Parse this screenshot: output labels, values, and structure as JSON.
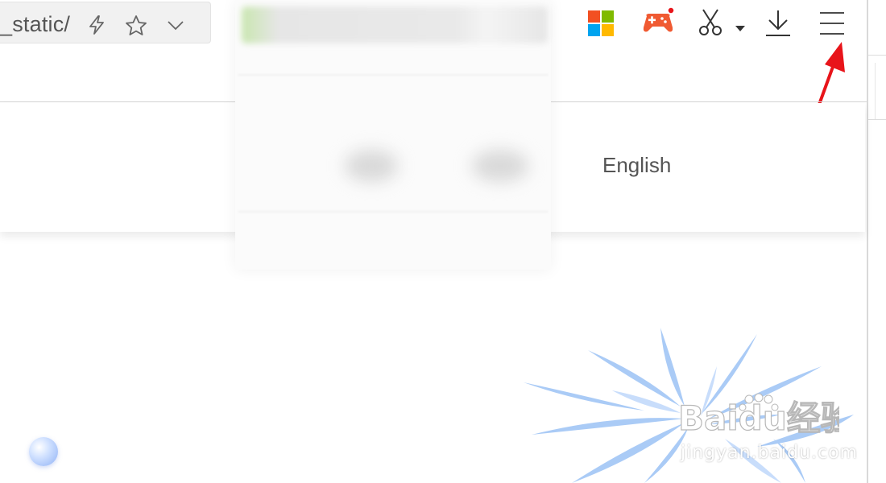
{
  "browser": {
    "address_bar": {
      "url_fragment": "_static/"
    },
    "toolbar": {
      "icons": [
        "lightning-icon",
        "star-icon",
        "chevron-down-icon",
        "apps-grid-icon",
        "game-controller-icon",
        "scissors-icon",
        "download-icon",
        "menu-icon"
      ]
    },
    "annotation": {
      "arrow_color": "#e8141a"
    }
  },
  "page": {
    "header": {
      "language_link": "English"
    }
  },
  "watermark": {
    "brand": "Baidu经验",
    "url": "jingyan.baidu.com"
  },
  "colors": {
    "apps_grid": [
      "#f25022",
      "#7fba00",
      "#00a4ef",
      "#ffb900"
    ],
    "game_icon": "#f05a32"
  }
}
